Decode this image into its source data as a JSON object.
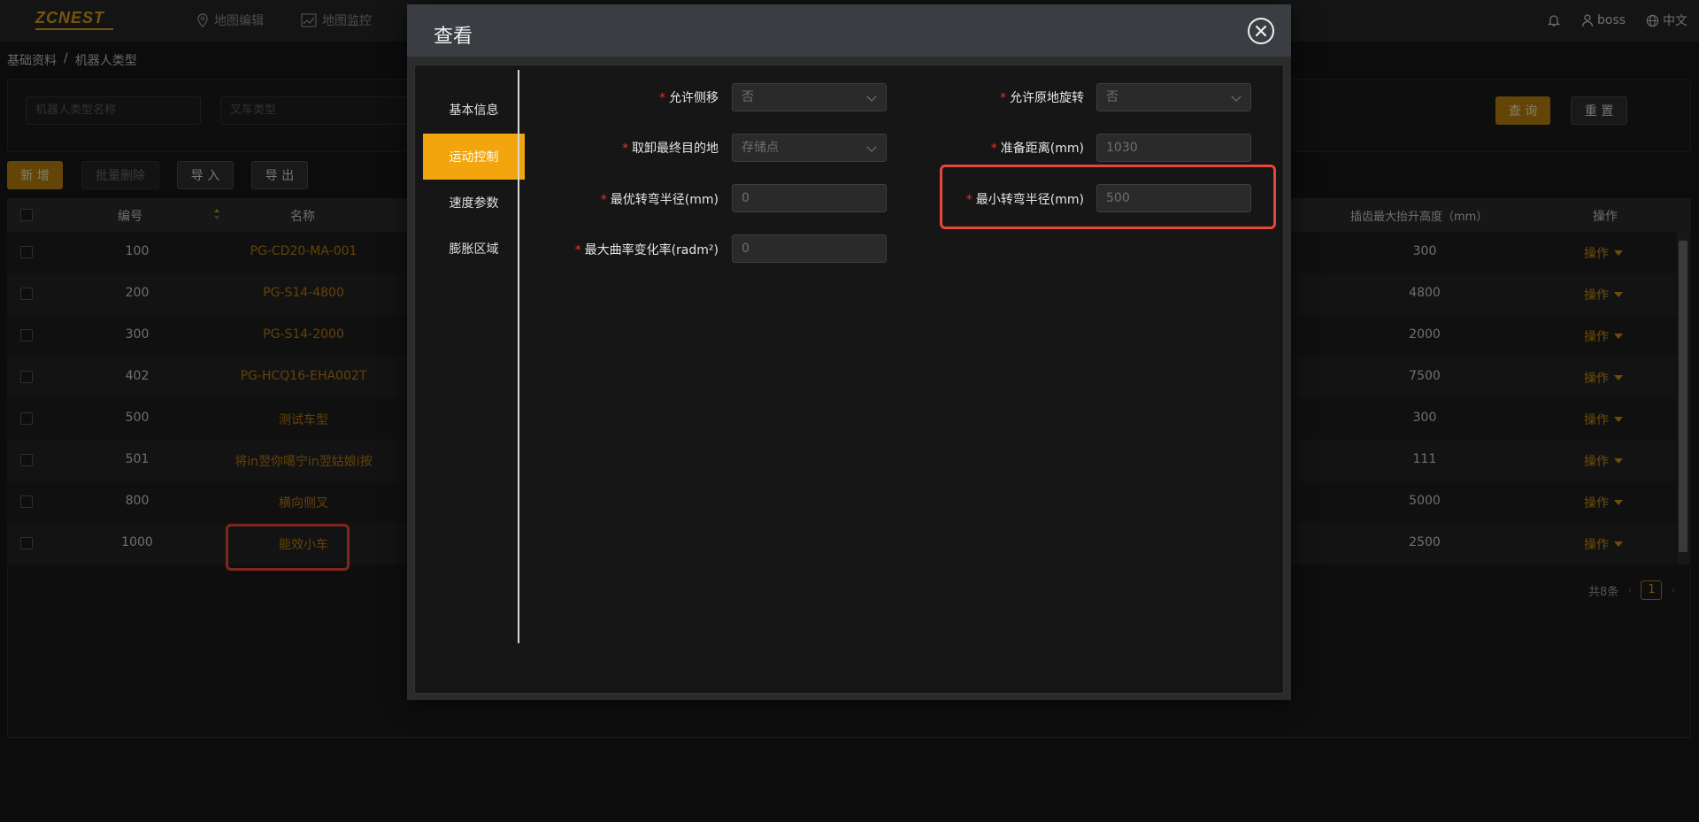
{
  "app": {
    "logo": "ZCNEST",
    "nav": [
      {
        "label": "地图编辑",
        "icon": "map-pin-icon"
      },
      {
        "label": "地图监控",
        "icon": "chart-line-icon"
      }
    ],
    "user": "boss",
    "language": "中文"
  },
  "breadcrumb": [
    "基础资料",
    "/",
    "机器人类型"
  ],
  "search": {
    "name_placeholder": "机器人类型名称",
    "forklift_placeholder": "叉车类型",
    "query_label": "查 询",
    "reset_label": "重 置"
  },
  "toolbar": {
    "add_label": "新 增",
    "batch_delete_label": "批量删除",
    "import_label": "导 入",
    "export_label": "导 出"
  },
  "table": {
    "headers": {
      "id": "编号",
      "name": "名称",
      "max_height": "插齿最大抬升高度（mm）",
      "ops": "操作"
    },
    "rows": [
      {
        "id": "100",
        "name": "PG-CD20-MA-001",
        "height": "300",
        "op": "操作"
      },
      {
        "id": "200",
        "name": "PG-S14-4800",
        "height": "4800",
        "op": "操作"
      },
      {
        "id": "300",
        "name": "PG-S14-2000",
        "height": "2000",
        "op": "操作"
      },
      {
        "id": "402",
        "name": "PG-HCQ16-EHA002T",
        "height": "7500",
        "op": "操作"
      },
      {
        "id": "500",
        "name": "测试车型",
        "height": "300",
        "op": "操作"
      },
      {
        "id": "501",
        "name": "将in翌你噶宁in翌姑娘i按",
        "height": "111",
        "op": "操作"
      },
      {
        "id": "800",
        "name": "横向侧叉",
        "height": "5000",
        "op": "操作"
      },
      {
        "id": "1000",
        "name": "能效小车",
        "height": "2500",
        "op": "操作"
      }
    ],
    "total": "共8条",
    "current_page": "1"
  },
  "modal": {
    "title": "查看",
    "tabs": [
      "基本信息",
      "运动控制",
      "速度参数",
      "膨胀区域"
    ],
    "active_tab": 1,
    "fields": {
      "allow_side_shift": {
        "label": "允许侧移",
        "value": "否"
      },
      "allow_spin": {
        "label": "允许原地旋转",
        "value": "否"
      },
      "final_target": {
        "label": "取卸最终目的地",
        "value": "存储点"
      },
      "prep_distance": {
        "label": "准备距离(mm)",
        "value": "1030"
      },
      "optimal_radius": {
        "label": "最优转弯半径(mm)",
        "value": "0"
      },
      "min_radius": {
        "label": "最小转弯半径(mm)",
        "value": "500"
      },
      "max_curvature": {
        "label": "最大曲率变化率(radm²)",
        "value": "0"
      }
    }
  },
  "colors": {
    "accent": "#f2a50c",
    "link": "#b5790f",
    "highlight": "#e8463a"
  }
}
